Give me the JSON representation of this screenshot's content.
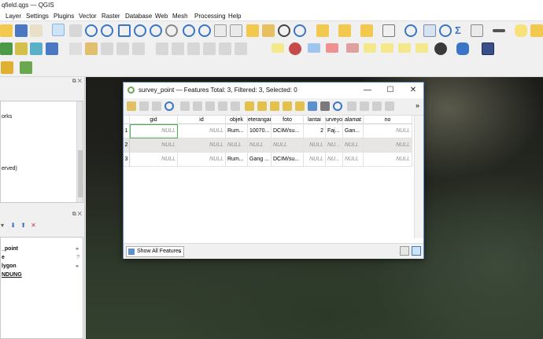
{
  "window": {
    "title": "qfield.qgs — QGIS"
  },
  "menu": [
    "Layer",
    "Settings",
    "Plugins",
    "Vector",
    "Raster",
    "Database",
    "Web",
    "Mesh",
    "Processing",
    "Help"
  ],
  "left_panel": {
    "browser_lines": [
      "orks",
      "erved)"
    ],
    "layers": [
      "_point",
      "e",
      "lygon",
      "NDUNG"
    ]
  },
  "dialog": {
    "title": "survey_point — Features Total: 3, Filtered: 3, Selected: 0",
    "more": "»",
    "columns": [
      "gid",
      "id",
      "objek",
      "eterangan",
      "foto",
      "lantai",
      "urveyo",
      "alamat",
      "no"
    ],
    "rows": [
      {
        "num": "1",
        "cells": [
          "NULL",
          "NULL",
          "Rum...",
          "10070...",
          "DCIM/su...",
          "2",
          "Faj...",
          "Gan...",
          "NULL"
        ]
      },
      {
        "num": "2",
        "cells": [
          "NULL",
          "NULL",
          "NULL",
          "NULL",
          "NULL",
          "NULL",
          "NU...",
          "NULL",
          "NULL"
        ]
      },
      {
        "num": "3",
        "cells": [
          "NULL",
          "NULL",
          "Rum...",
          "Gang ...",
          "DCIM/su...",
          "NULL",
          "NU...",
          "NULL",
          "NULL"
        ]
      }
    ],
    "filter_button": "Show All Features",
    "filter_caret": "⌄"
  },
  "colors": {
    "accent": "#4caf50",
    "title_border": "#5a8ac8",
    "null_text": "#8a8a8a"
  }
}
